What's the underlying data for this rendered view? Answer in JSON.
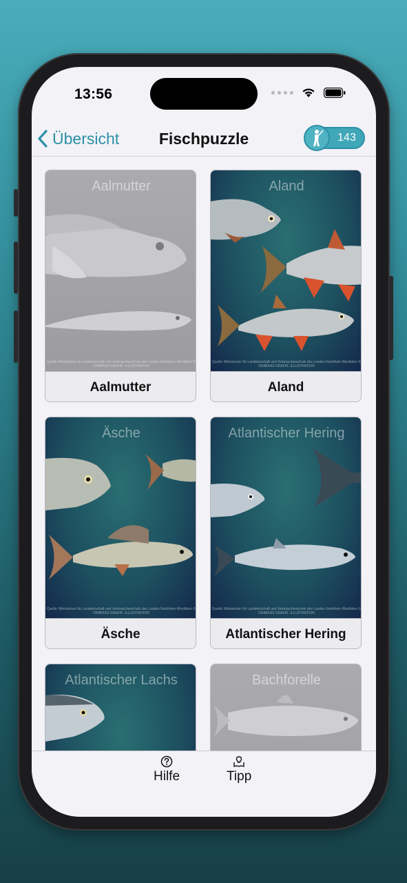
{
  "status": {
    "time": "13:56"
  },
  "nav": {
    "back_label": "Übersicht",
    "title": "Fischpuzzle",
    "score": "143"
  },
  "cards": [
    {
      "image_title": "Aalmutter",
      "label": "Aalmutter",
      "locked": true
    },
    {
      "image_title": "Aland",
      "label": "Aland",
      "locked": false
    },
    {
      "image_title": "Äsche",
      "label": "Äsche",
      "locked": false
    },
    {
      "image_title": "Atlantischer Hering",
      "label": "Atlantischer Hering",
      "locked": false
    },
    {
      "image_title": "Atlantischer Lachs",
      "label": "",
      "locked": false
    },
    {
      "image_title": "Bachforelle",
      "label": "",
      "locked": true
    }
  ],
  "credit_text": "Quelle: Ministerium für Landwirtschaft und Verbraucherschutz des Landes Nordrhein-Westfalen © DINBIKAS GRAFIK. ILLUSTRATION",
  "tabbar": {
    "help_label": "Hilfe",
    "tip_label": "Tipp"
  },
  "colors": {
    "accent": "#2d8fa6",
    "score_bg": "#3fa7b8"
  }
}
